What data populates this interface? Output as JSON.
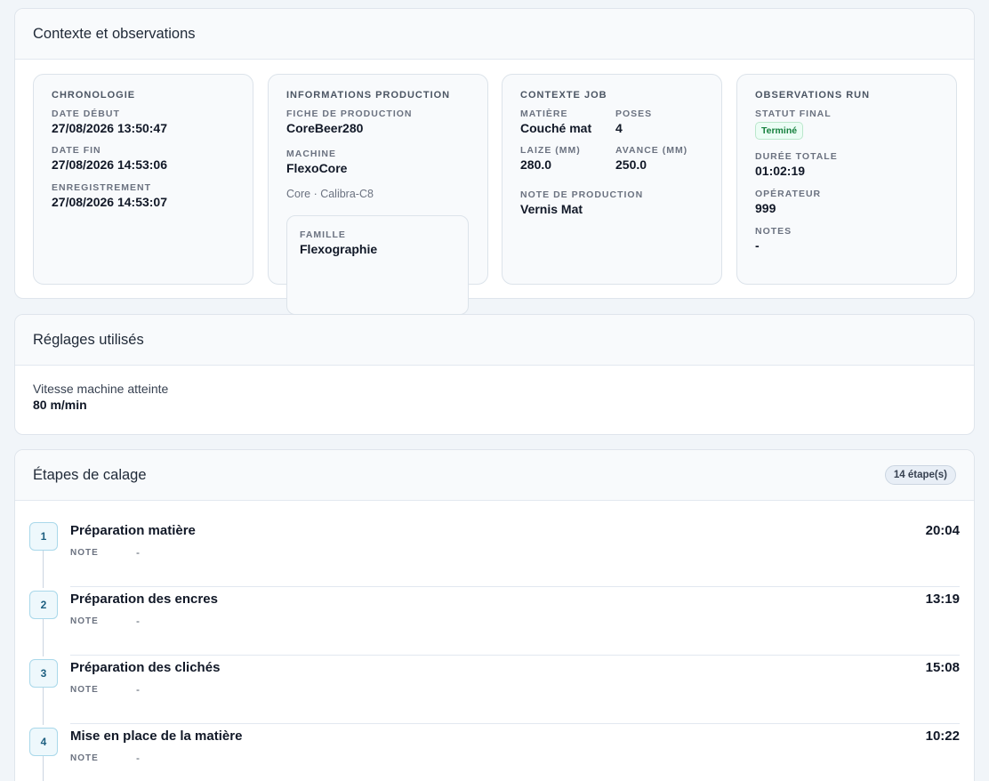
{
  "context": {
    "title": "Contexte et observations",
    "chronologie": {
      "title": "Chronologie",
      "date_debut_label": "Date début",
      "date_debut": "27/08/2026 13:50:47",
      "date_fin_label": "Date fin",
      "date_fin": "27/08/2026 14:53:06",
      "enregistrement_label": "Enregistrement",
      "enregistrement": "27/08/2026 14:53:07"
    },
    "production": {
      "title": "Informations production",
      "fiche_label": "Fiche de production",
      "fiche": "CoreBeer280",
      "machine_label": "Machine",
      "machine": "FlexoCore",
      "machine_sub": "Core · Calibra-C8",
      "famille_label": "Famille",
      "famille": "Flexographie"
    },
    "job": {
      "title": "Contexte job",
      "matiere_label": "Matière",
      "matiere": "Couché mat",
      "poses_label": "Poses",
      "poses": "4",
      "laize_label": "Laize (mm)",
      "laize": "280.0",
      "avance_label": "Avance (mm)",
      "avance": "250.0",
      "note_label": "Note de production",
      "note": "Vernis Mat"
    },
    "run": {
      "title": "Observations run",
      "statut_label": "Statut final",
      "statut": "Terminé",
      "duree_label": "Durée totale",
      "duree": "01:02:19",
      "operateur_label": "Opérateur",
      "operateur": "999",
      "notes_label": "Notes",
      "notes": "-"
    }
  },
  "reglages": {
    "title": "Réglages utilisés",
    "vitesse_label": "Vitesse machine atteinte",
    "vitesse": "80 m/min"
  },
  "etapes": {
    "title": "Étapes de calage",
    "count": "14 étape(s)",
    "note_label": "NOTE",
    "items": [
      {
        "num": "1",
        "title": "Préparation matière",
        "time": "20:04",
        "note": "-"
      },
      {
        "num": "2",
        "title": "Préparation des encres",
        "time": "13:19",
        "note": "-"
      },
      {
        "num": "3",
        "title": "Préparation des clichés",
        "time": "15:08",
        "note": "-"
      },
      {
        "num": "4",
        "title": "Mise en place de la matière",
        "time": "10:22",
        "note": "-"
      }
    ]
  },
  "colors": {
    "status_success": "#15803d",
    "step_accent": "#1d5f80",
    "background": "#f1f5f9"
  }
}
